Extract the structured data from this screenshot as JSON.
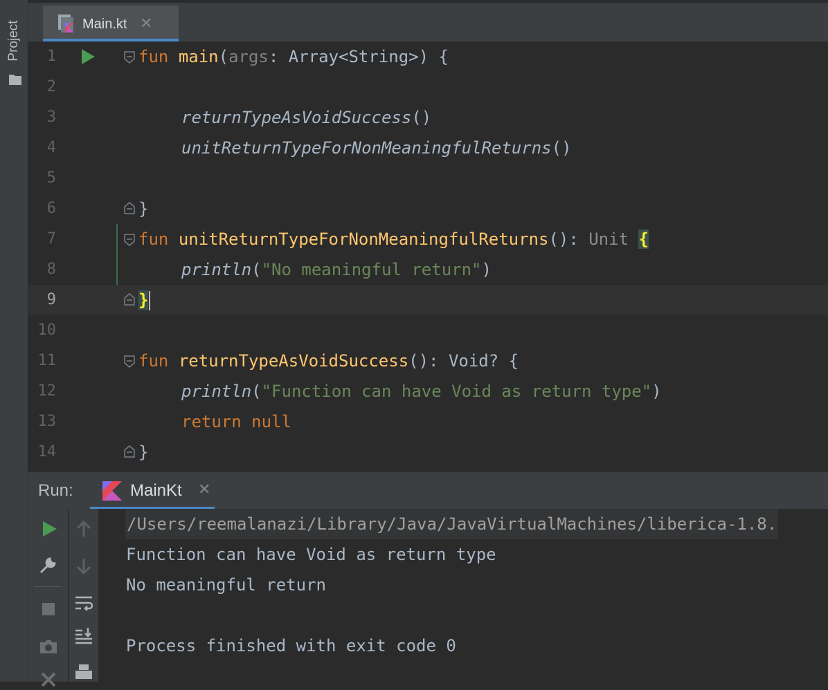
{
  "sidebar": {
    "project_label": "Project"
  },
  "editor_tab": {
    "filename": "Main.kt"
  },
  "editor": {
    "lines": [
      {
        "num": "1"
      },
      {
        "num": "2"
      },
      {
        "num": "3"
      },
      {
        "num": "4"
      },
      {
        "num": "5"
      },
      {
        "num": "6"
      },
      {
        "num": "7"
      },
      {
        "num": "8"
      },
      {
        "num": "9"
      },
      {
        "num": "10"
      },
      {
        "num": "11"
      },
      {
        "num": "12"
      },
      {
        "num": "13"
      },
      {
        "num": "14"
      }
    ],
    "current_line": "9",
    "code": {
      "l1": {
        "kw": "fun",
        "name": "main",
        "open": "(",
        "param": "args",
        "colon": ": ",
        "type": "Array<String>",
        "tail": ") {"
      },
      "l3": {
        "call": "returnTypeAsVoidSuccess",
        "parens": "()"
      },
      "l4": {
        "call": "unitReturnTypeForNonMeaningfulReturns",
        "parens": "()"
      },
      "l6": {
        "text": "}"
      },
      "l7": {
        "kw": "fun",
        "name": "unitReturnTypeForNonMeaningfulReturns",
        "sig": "(): ",
        "ret": "Unit",
        "brace": "{"
      },
      "l8": {
        "call": "println",
        "open": "(",
        "str": "\"No meaningful return\"",
        "close": ")"
      },
      "l9": {
        "brace": "}"
      },
      "l11": {
        "kw": "fun",
        "name": "returnTypeAsVoidSuccess",
        "sig": "(): Void? {"
      },
      "l12": {
        "call": "println",
        "open": "(",
        "str": "\"Function can have Void as return type\"",
        "close": ")"
      },
      "l13": {
        "kw1": "return",
        "kw2": "null"
      },
      "l14": {
        "text": "}"
      }
    }
  },
  "run_panel": {
    "label": "Run:",
    "tab_label": "MainKt",
    "output": [
      "/Users/reemalanazi/Library/Java/JavaVirtualMachines/liberica-1.8.",
      "Function can have Void as return type",
      "No meaningful return",
      "",
      "Process finished with exit code 0"
    ]
  },
  "colors": {
    "accent": "#4a88c7",
    "run_green": "#499c54",
    "keyword": "#cc7832",
    "function": "#ffc66d",
    "string": "#6a8759"
  }
}
